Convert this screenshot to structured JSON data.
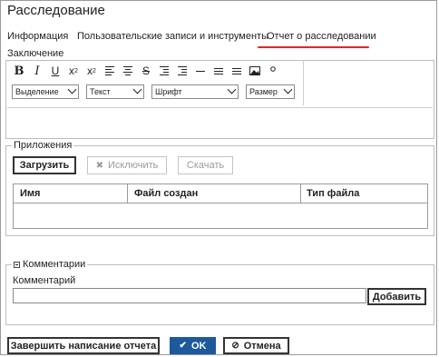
{
  "window": {
    "title": "Расследование"
  },
  "tabs": [
    {
      "label": "Информация"
    },
    {
      "label": "Пользовательские записи и инструменты"
    },
    {
      "label": "Отчет о расследовании"
    }
  ],
  "active_tab_index": 2,
  "accent_color": "#e0262b",
  "conclusion": {
    "label": "Заключение",
    "toolbar_buttons": [
      "B",
      "I",
      "U",
      "x₂",
      "x²",
      "align-left",
      "align-center",
      "S",
      "indent-left",
      "indent-right",
      "hr",
      "list-ul",
      "list-ol",
      "image",
      "link"
    ],
    "dropdowns": [
      {
        "value": "Выделение"
      },
      {
        "value": "Текст"
      },
      {
        "value": "Шрифт"
      },
      {
        "value": "Размер"
      }
    ]
  },
  "attachments": {
    "legend": "Приложения",
    "upload_label": "Загрузить",
    "exclude_label": "Исключить",
    "download_label": "Скачать",
    "columns": [
      "Имя",
      "Файл создан",
      "Тип файла"
    ]
  },
  "comments": {
    "legend": "Комментарии",
    "field_label": "Комментарий",
    "input_value": "",
    "add_label": "Добавить"
  },
  "footer": {
    "finish_label": "Завершить написание отчета",
    "ok_label": "OK",
    "cancel_label": "Отмена",
    "ok_color": "#1d5a9b"
  }
}
